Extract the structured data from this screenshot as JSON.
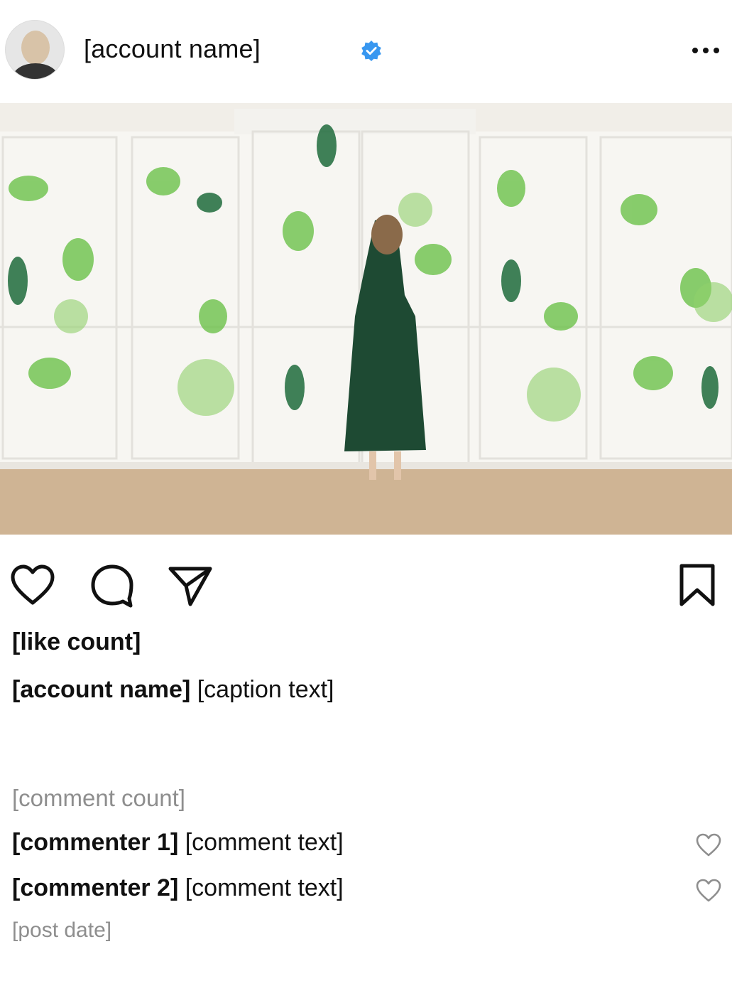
{
  "post": {
    "username": "[account name]",
    "verified": true,
    "image_alt": "[post photo]"
  },
  "stats": {
    "likes": "[like count]",
    "comments_count": "[comment count]"
  },
  "caption": {
    "username": "[account name]",
    "text": "[caption text]"
  },
  "comments": [
    {
      "username": "[commenter 1]",
      "text": "[comment text]"
    },
    {
      "username": "[commenter 2]",
      "text": "[comment text]"
    }
  ],
  "date": "[post date]",
  "icons": [
    "more-options-icon",
    "verified-badge-icon",
    "like-icon",
    "comment-icon",
    "share-icon",
    "save-icon",
    "comment-like-icon"
  ],
  "colors": {
    "verified": "#3897f0",
    "muted": "#8e8e8e",
    "text": "#111111"
  }
}
